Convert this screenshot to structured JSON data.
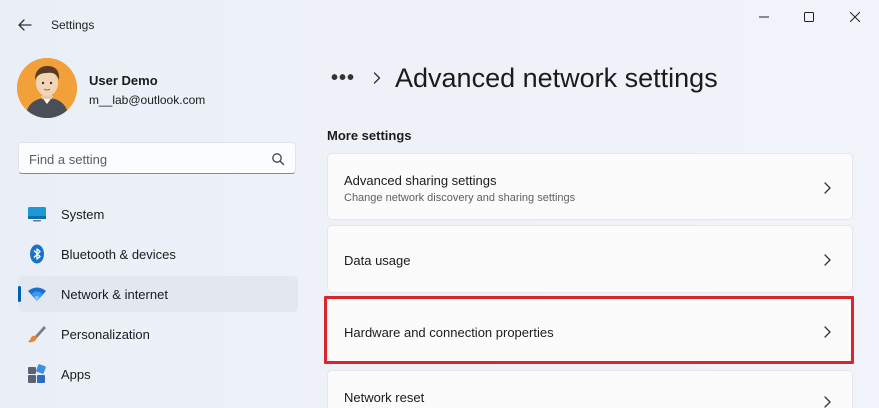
{
  "window": {
    "title": "Settings",
    "controls": {
      "minimize": "minimize",
      "maximize": "maximize",
      "close": "close"
    }
  },
  "profile": {
    "name": "User Demo",
    "email": "m__lab@outlook.com"
  },
  "search": {
    "placeholder": "Find a setting"
  },
  "nav": {
    "items": [
      {
        "label": "System",
        "icon": "monitor-icon"
      },
      {
        "label": "Bluetooth & devices",
        "icon": "bluetooth-icon"
      },
      {
        "label": "Network & internet",
        "icon": "wifi-icon",
        "selected": true
      },
      {
        "label": "Personalization",
        "icon": "brush-icon"
      },
      {
        "label": "Apps",
        "icon": "apps-icon"
      }
    ]
  },
  "main": {
    "breadcrumb_more": "•••",
    "page_title": "Advanced network settings",
    "section_label": "More settings",
    "cards": [
      {
        "title": "Advanced sharing settings",
        "subtitle": "Change network discovery and sharing settings"
      },
      {
        "title": "Data usage"
      },
      {
        "title": "Hardware and connection properties",
        "highlighted": true
      },
      {
        "title": "Network reset"
      }
    ]
  },
  "colors": {
    "accent": "#005fb8",
    "highlight": "#d7262e",
    "background": "#eef2f8",
    "card": "#fbfbfc"
  }
}
